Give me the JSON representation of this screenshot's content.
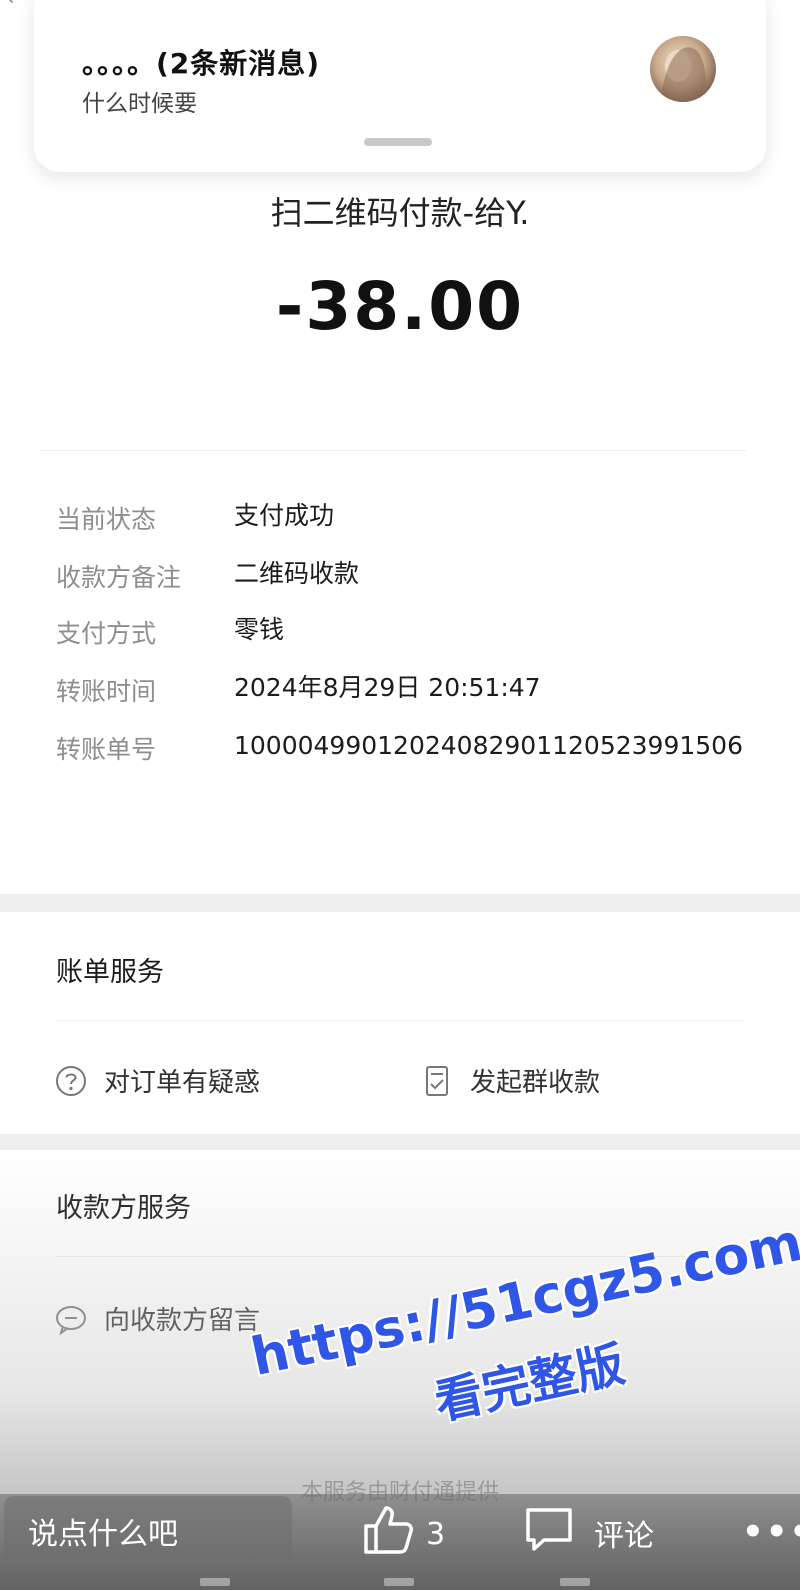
{
  "notification": {
    "title": "。。。。(2条新消息)",
    "subtitle": "什么时候要"
  },
  "payment": {
    "title": "扫二维码付款-给Y.",
    "amount": "-38.00"
  },
  "details": [
    {
      "label": "当前状态",
      "value": "支付成功"
    },
    {
      "label": "收款方备注",
      "value": "二维码收款"
    },
    {
      "label": "支付方式",
      "value": "零钱"
    },
    {
      "label": "转账时间",
      "value": "2024年8月29日 20:51:47"
    },
    {
      "label": "转账单号",
      "value": "10000499012024082901120523991506"
    }
  ],
  "bill_service": {
    "title": "账单服务",
    "question": "对订单有疑惑",
    "group_collect": "发起群收款"
  },
  "payee_service": {
    "title": "收款方服务",
    "message": "向收款方留言"
  },
  "footer_note": "本服务由财付通提供",
  "watermark": {
    "url": "https://51cgz5.com",
    "sub": "看完整版"
  },
  "bottom_bar": {
    "comment_placeholder": "说点什么吧",
    "like_count": "3",
    "comment_label": "评论",
    "more_label": "•••"
  },
  "colors": {
    "watermark": "#2f56e6",
    "label_gray": "#8e8e8e"
  }
}
